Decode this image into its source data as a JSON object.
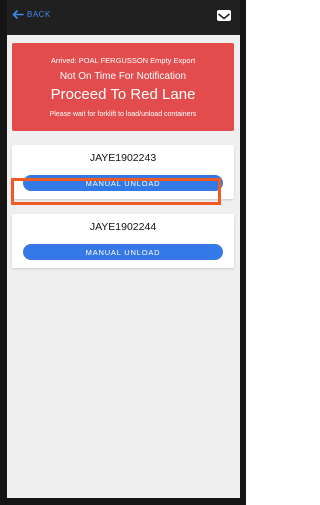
{
  "topbar": {
    "back_label": "BACK",
    "back_icon": "arrow-left-icon",
    "mail_icon": "mail-icon"
  },
  "alert": {
    "line1": "Arrived: POAL FERGUSSON Empty Export",
    "line2": "Not On Time For Notification",
    "line3": "Proceed To Red Lane",
    "line4": "Please wait for forklift to load/unload containers",
    "color": "#e34c4c"
  },
  "containers": [
    {
      "number": "JAYE1902243",
      "button_label": "MANUAL UNLOAD"
    },
    {
      "number": "JAYE1902244",
      "button_label": "MANUAL UNLOAD"
    }
  ],
  "colors": {
    "accent": "#3479e6",
    "highlight": "#f05a24"
  }
}
